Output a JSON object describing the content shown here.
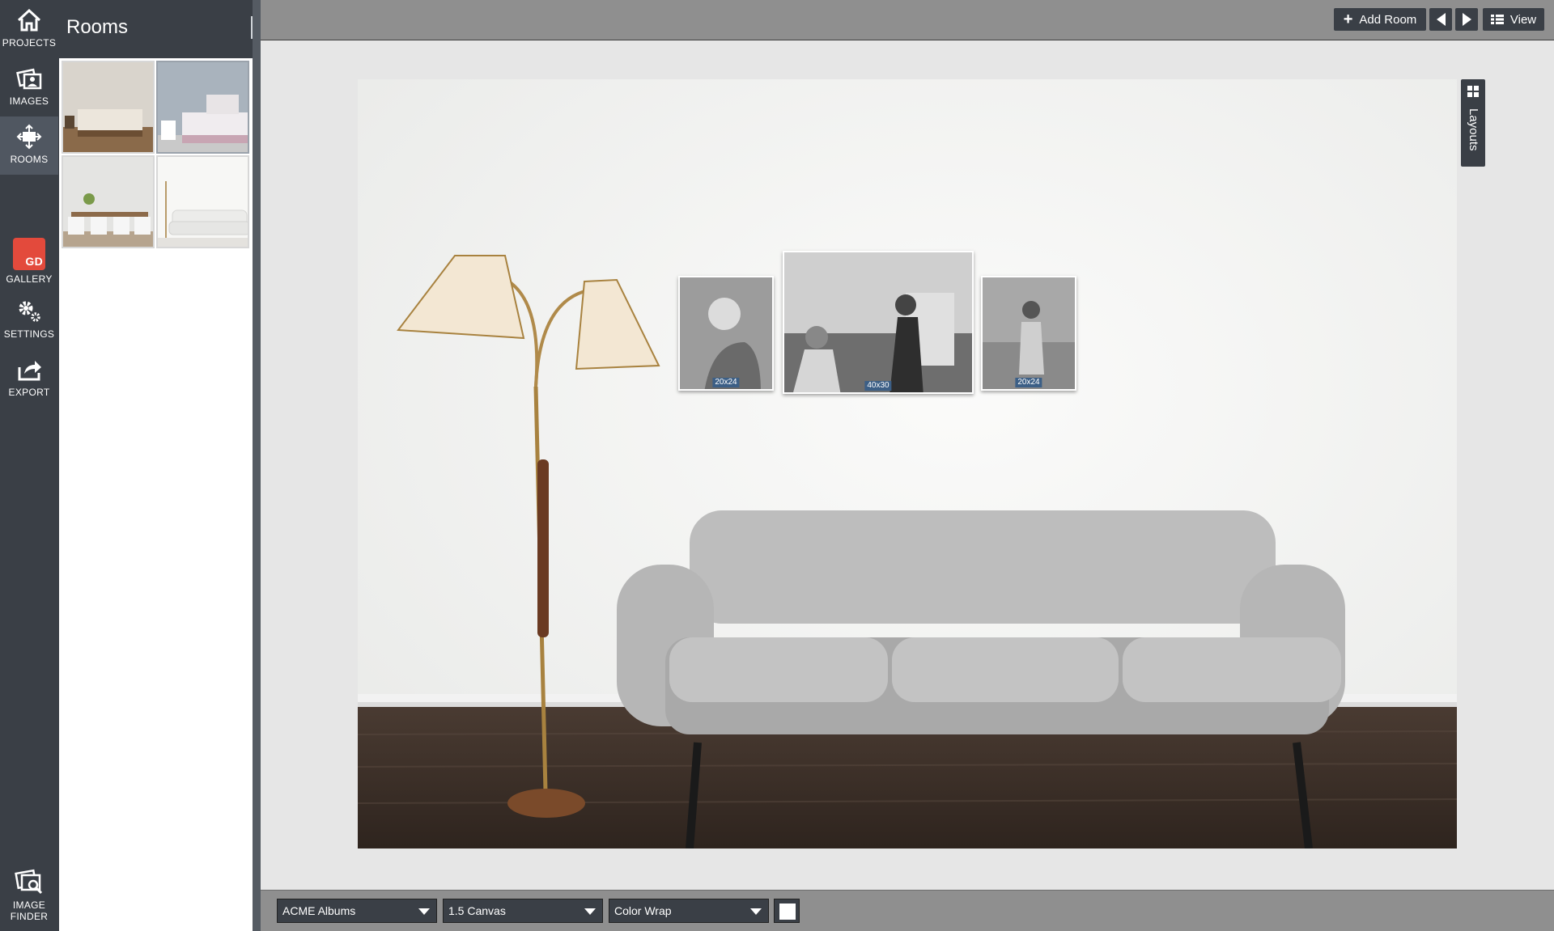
{
  "nav": {
    "items": [
      {
        "label": "PROJECTS",
        "icon": "home-icon"
      },
      {
        "label": "IMAGES",
        "icon": "images-icon"
      },
      {
        "label": "ROOMS",
        "icon": "rooms-icon"
      },
      {
        "label": "GALLERY",
        "icon": "gallery-badge",
        "badge_text": "GD"
      },
      {
        "label": "SETTINGS",
        "icon": "gears-icon"
      },
      {
        "label": "EXPORT",
        "icon": "export-icon"
      }
    ],
    "bottom_label": "IMAGE FINDER",
    "bottom_icon": "image-finder-icon"
  },
  "panel": {
    "title": "Rooms",
    "rooms": [
      "bedroom-1",
      "bedroom-2",
      "dining-room",
      "living-room-sofa"
    ]
  },
  "topbar": {
    "add_room_label": "Add Room",
    "view_label": "View"
  },
  "canvas": {
    "layouts_label": "Layouts",
    "prints": [
      {
        "size": "20x24"
      },
      {
        "size": "40x30"
      },
      {
        "size": "20x24"
      }
    ]
  },
  "bottombar": {
    "vendor_select": "ACME Albums",
    "product_select": "1.5 Canvas",
    "wrap_select": "Color Wrap",
    "swatch_color": "#ffffff"
  }
}
